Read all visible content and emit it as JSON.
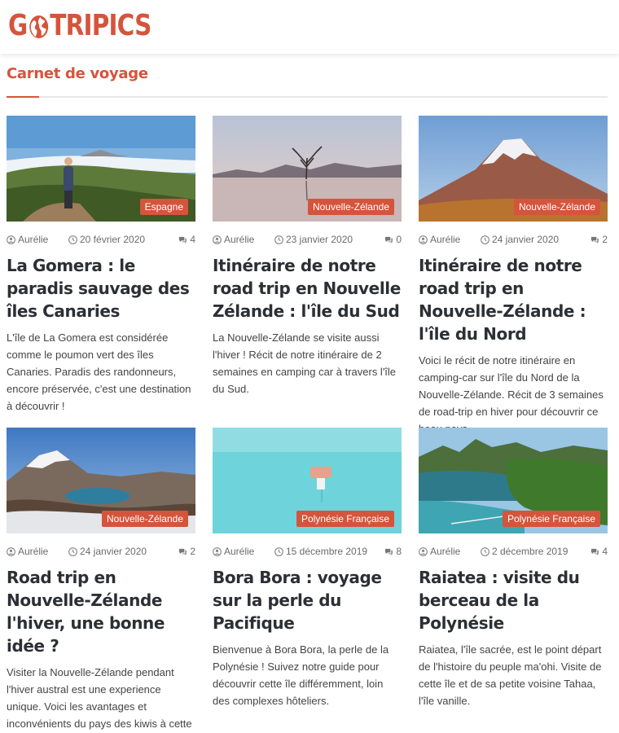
{
  "header": {
    "logo_g": "G",
    "logo_rest": "TRIPICS",
    "brand_color": "#d5543c"
  },
  "section": {
    "title": "Carnet de voyage"
  },
  "icons": {
    "author": "user-icon",
    "date": "clock-icon",
    "comments": "comments-icon"
  },
  "posts": [
    {
      "badge": "Espagne",
      "author": "Aurélie",
      "date": "20 février 2020",
      "comments": "4",
      "title": "La Gomera : le paradis sauvage des îles Canaries",
      "excerpt": "L'île de La Gomera est considérée comme le poumon vert des îles Canaries. Paradis des randonneurs, encore préservée, c'est une destination à découvrir !"
    },
    {
      "badge": "Nouvelle-Zélande",
      "author": "Aurélie",
      "date": "23 janvier 2020",
      "comments": "0",
      "title": "Itinéraire de notre road trip en Nouvelle Zélande : l'île du Sud",
      "excerpt": "La Nouvelle-Zélande se visite aussi l'hiver ! Récit de notre itinéraire de 2 semaines en camping car à travers l'île du Sud."
    },
    {
      "badge": "Nouvelle-Zélande",
      "author": "Aurélie",
      "date": "24 janvier 2020",
      "comments": "2",
      "title": "Itinéraire de notre road trip en Nouvelle-Zélande : l'île du Nord",
      "excerpt": "Voici le récit de notre itinéraire en camping-car sur l'île du Nord de la Nouvelle-Zélande. Récit de 3 semaines de road-trip en hiver pour découvrir ce beau pays."
    },
    {
      "badge": "Nouvelle-Zélande",
      "author": "Aurélie",
      "date": "24 janvier 2020",
      "comments": "2",
      "title": "Road trip en Nouvelle-Zélande l'hiver, une bonne idée ?",
      "excerpt": "Visiter la Nouvelle-Zélande pendant l'hiver austral est une experience unique. Voici les avantages et inconvénients du pays des kiwis à cette saison."
    },
    {
      "badge": "Polynésie Française",
      "author": "Aurélie",
      "date": "15 décembre 2019",
      "comments": "8",
      "title": "Bora Bora : voyage sur la perle du Pacifique",
      "excerpt": "Bienvenue à Bora Bora, la perle de la Polynésie ! Suivez notre guide pour découvrir cette île différemment, loin des complexes hôteliers."
    },
    {
      "badge": "Polynésie Française",
      "author": "Aurélie",
      "date": "2 décembre 2019",
      "comments": "4",
      "title": "Raiatea : visite du berceau de la Polynésie",
      "excerpt": "Raiatea, l'île sacrée, est le point départ de l'histoire du peuple ma'ohi. Visite de cette île et de sa petite voisine Tahaa, l'île vanille."
    }
  ]
}
